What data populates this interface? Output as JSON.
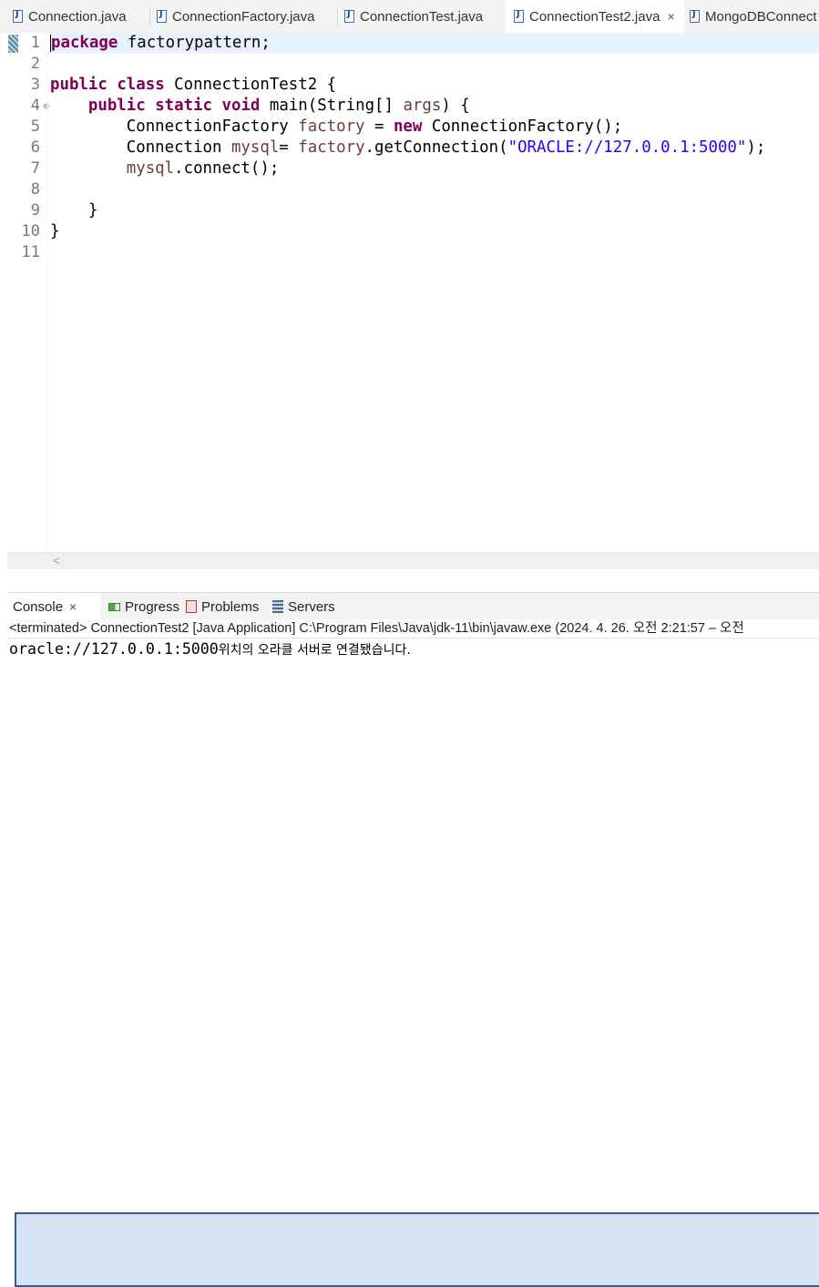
{
  "editor_tabs": [
    {
      "label": "Connection.java",
      "active": false
    },
    {
      "label": "ConnectionFactory.java",
      "active": false
    },
    {
      "label": "ConnectionTest.java",
      "active": false
    },
    {
      "label": "ConnectionTest2.java",
      "active": true,
      "close": "×"
    },
    {
      "label": "MongoDBConnect",
      "active": false
    }
  ],
  "code": {
    "line_numbers": [
      "1",
      "2",
      "3",
      "4",
      "5",
      "6",
      "7",
      "8",
      "9",
      "10",
      "11"
    ],
    "fold_marker": "⊖",
    "line1": {
      "kw": "package",
      "rest": " factorypattern;"
    },
    "line3": {
      "kw1": "public",
      "kw2": "class",
      "rest": " ConnectionTest2 {"
    },
    "line4": {
      "indent": "    ",
      "kw1": "public",
      "kw2": "static",
      "kw3": "void",
      "mid": " main(String[] ",
      "var": "args",
      "end": ") {"
    },
    "line5": {
      "indent": "        ",
      "type": "ConnectionFactory ",
      "var": "factory",
      "mid": " = ",
      "kw": "new",
      "end": " ConnectionFactory();"
    },
    "line6": {
      "indent": "        ",
      "type": "Connection ",
      "var": "mysql",
      "mid": "= ",
      "var2": "factory",
      "call": ".getConnection(",
      "str": "\"ORACLE://127.0.0.1:5000\"",
      "end": ");"
    },
    "line7": {
      "indent": "        ",
      "var": "mysql",
      "end": ".connect();"
    },
    "line9": {
      "text": "    }"
    },
    "line10": {
      "text": "}"
    }
  },
  "hscroll_arrow": "<",
  "view_tabs": {
    "console": {
      "label": "Console",
      "close": "×"
    },
    "progress": {
      "label": "Progress"
    },
    "problems": {
      "label": "Problems"
    },
    "servers": {
      "label": "Servers"
    }
  },
  "console": {
    "header": "<terminated> ConnectionTest2 [Java Application] C:\\Program Files\\Java\\jdk-11\\bin\\javaw.exe  (2024. 4. 26. 오전 2:21:57 – 오전",
    "output_ascii": "oracle://127.0.0.1:5000",
    "output_korean": "위치의 오라클 서버로 연결됐습니다."
  },
  "colors": {
    "keyword": "#7f0055",
    "variable": "#6a3e3e",
    "string": "#2a00ff",
    "current_line": "#e8f2fe"
  }
}
